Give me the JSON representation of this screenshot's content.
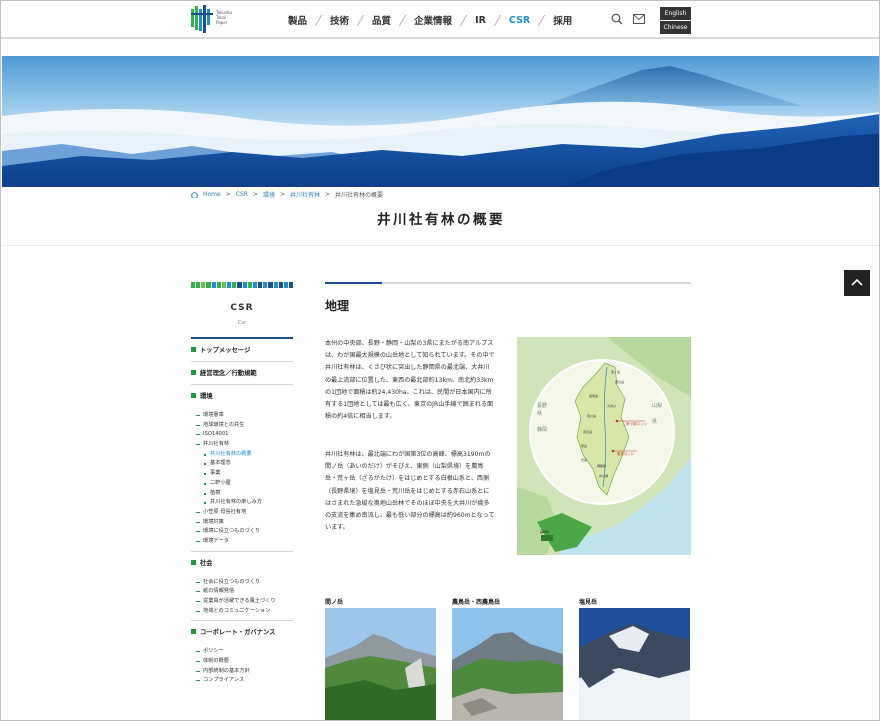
{
  "header": {
    "logo_text": [
      "Tokushu",
      "Tokai",
      "Paper"
    ],
    "nav": [
      {
        "label": "製品",
        "active": false
      },
      {
        "label": "技術",
        "active": false
      },
      {
        "label": "品質",
        "active": false
      },
      {
        "label": "企業情報",
        "active": false
      },
      {
        "label": "IR",
        "active": false
      },
      {
        "label": "CSR",
        "active": true
      },
      {
        "label": "採用",
        "active": false
      }
    ],
    "search_icon": "search-icon",
    "mail_icon": "mail-icon",
    "lang_english": "English",
    "lang_chinese": "Chinese"
  },
  "breadcrumb": {
    "home": "Home",
    "csr": "CSR",
    "env": "環境",
    "forest": "井川社有林",
    "current": "井川社有林の概要",
    "sep": ">"
  },
  "page_title": "井川社有林の概要",
  "sidebar": {
    "title": "CSR",
    "subtitle": "Csr",
    "sections": [
      {
        "label": "トップメッセージ"
      },
      {
        "label": "経営理念／行動規範"
      },
      {
        "label": "環境",
        "items": [
          {
            "label": "環境憲章",
            "level": 1
          },
          {
            "label": "地球環境との共生",
            "level": 1
          },
          {
            "label": "ISO14001",
            "level": 1
          },
          {
            "label": "井川社有林",
            "level": 1
          },
          {
            "label": "井川社有林の概要",
            "level": 2,
            "current": true
          },
          {
            "label": "基本理念",
            "level": 2
          },
          {
            "label": "事業",
            "level": 2
          },
          {
            "label": "二軒小屋",
            "level": 2
          },
          {
            "label": "植樹",
            "level": 2
          },
          {
            "label": "井川社有林の楽しみ方",
            "level": 2
          },
          {
            "label": "小笠原 母島社有地",
            "level": 1
          },
          {
            "label": "環境対策",
            "level": 1
          },
          {
            "label": "環境に役立つものづくり",
            "level": 1
          },
          {
            "label": "環境データ",
            "level": 1
          }
        ]
      },
      {
        "label": "社会",
        "items": [
          {
            "label": "社会に役立つものづくり",
            "level": 1
          },
          {
            "label": "紙の情報発信",
            "level": 1
          },
          {
            "label": "従業員が活躍できる風土づくり",
            "level": 1
          },
          {
            "label": "地域とのコミュニケーション",
            "level": 1
          }
        ]
      },
      {
        "label": "コーポレート・ガバナンス",
        "items": [
          {
            "label": "ポリシー",
            "level": 1
          },
          {
            "label": "体制の概要",
            "level": 1
          },
          {
            "label": "内部統制の基本方針",
            "level": 1
          },
          {
            "label": "コンプライアンス",
            "level": 1
          }
        ]
      }
    ]
  },
  "main": {
    "heading": "地理",
    "paragraphs": [
      "本州の中央部、長野・静岡・山梨の3県にまたがる南アルプスは、わが国最大規模の山岳地として知られています。その中で井川社有林は、くさび状に突出した静岡県の最北端、大井川の最上流部に位置した、東西の最北部約13km、南北約33kmの1団地で面積は約24,430ha。これは、民間が日本国内に所有する1団地としては最も広く、東京のJR山手線で囲まれる面積の約4倍に相当します。",
      "井川社有林は、最北端にわが国第3位の高峰、標高3190mの間ノ岳（あいのだけ）がそびえ、東側（山梨県境）を農鳥岳・荒ヶ岳（ざるがたけ）をはじめとする白根山系と、西側（長野県境）を塩見岳・荒川岳をはじめとする赤石山系とにはさまれた急峻な奥地山岳林でそのほぼ中央を大井川が幾多の支流を集め南流し、最も低い部分の標高は約960mとなっています。"
    ],
    "map_labels": {
      "nagano": "長野",
      "shizuoka": "静岡",
      "yamanashi": "山梨",
      "prefecture": "県",
      "hut1": "二軒小屋ロッジ",
      "hut2": "椹島ロッジ",
      "places": [
        "間ノ岳",
        "農鳥岳",
        "塩見岳",
        "荒川岳",
        "赤石岳",
        "聖岳",
        "光岳",
        "大井川",
        "井川湖",
        "畑薙湖"
      ],
      "city": "静岡市"
    },
    "mountains": [
      {
        "label": "間ノ岳"
      },
      {
        "label": "農鳥岳・西農鳥岳"
      },
      {
        "label": "塩見岳"
      }
    ]
  },
  "colors": {
    "accent_blue": "#1d8fd1",
    "navy": "#1b4f8e",
    "green": "#1e9a3a"
  }
}
